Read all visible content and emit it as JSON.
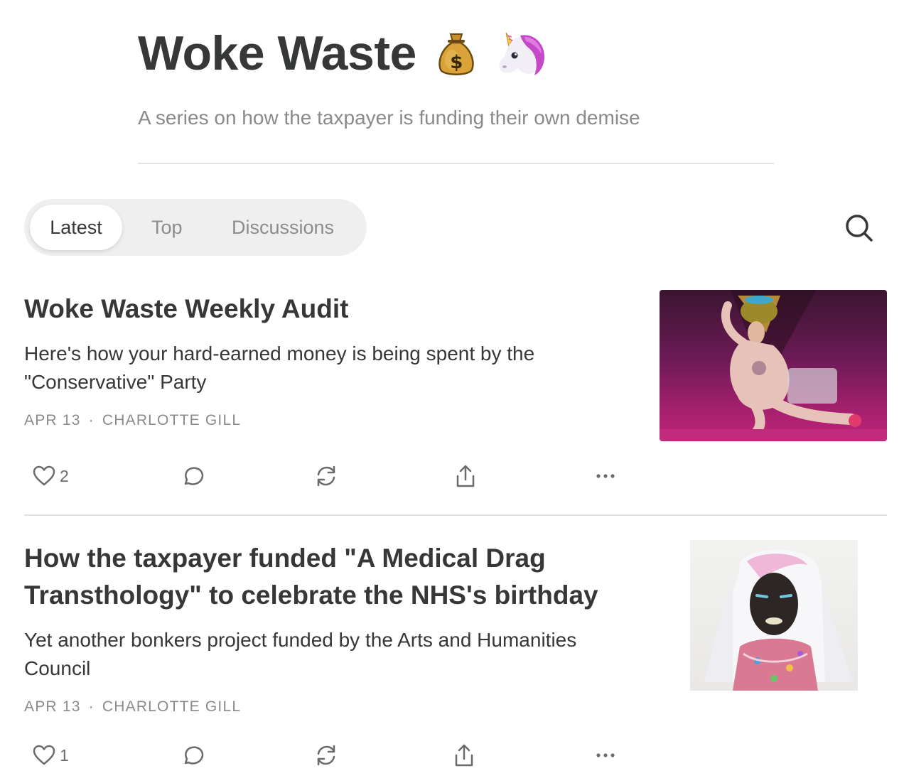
{
  "publication": {
    "title": "Woke Waste",
    "subtitle": "A series on how the taxpayer is funding their own demise",
    "title_emojis": [
      "money-bag",
      "unicorn"
    ]
  },
  "tabs": [
    {
      "label": "Latest",
      "active": true
    },
    {
      "label": "Top",
      "active": false
    },
    {
      "label": "Discussions",
      "active": false
    }
  ],
  "search": {
    "icon": "search-icon"
  },
  "posts": [
    {
      "title": "Woke Waste Weekly Audit",
      "subtitle": "Here's how your hard-earned money is being spent by the \"Conservative\" Party",
      "date": "APR 13",
      "separator": "·",
      "author": "CHARLOTTE GILL",
      "likes": "2",
      "icons": [
        "heart-icon",
        "comment-icon",
        "restack-icon",
        "share-icon",
        "more-icon"
      ]
    },
    {
      "title": "How the taxpayer funded \"A Medical Drag Transthology\" to celebrate the NHS's birthday",
      "subtitle": "Yet another bonkers project funded by the Arts and Humanities Council",
      "date": "APR 13",
      "separator": "·",
      "author": "CHARLOTTE GILL",
      "likes": "1",
      "icons": [
        "heart-icon",
        "comment-icon",
        "restack-icon",
        "share-icon",
        "more-icon"
      ]
    }
  ],
  "colors": {
    "text": "#363737",
    "muted": "#8a8a8a",
    "tab_bg": "#efefef",
    "divider": "#e3e3e3"
  }
}
